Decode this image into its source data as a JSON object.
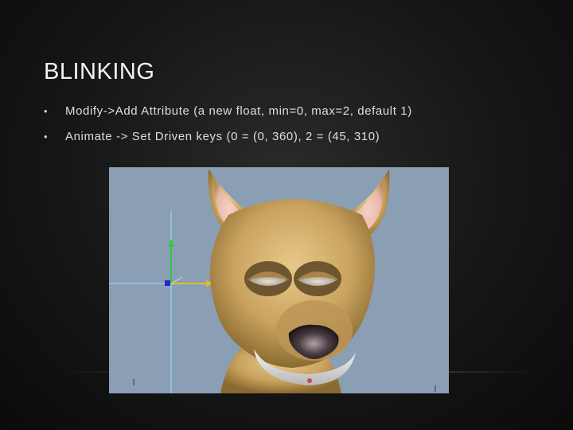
{
  "slide": {
    "title": "BLINKING",
    "bullets": [
      {
        "marker": "•",
        "text": "Modify->Add Attribute (a new float, min=0, max=2, default 1)"
      },
      {
        "marker": "•",
        "text": "Animate -> Set Driven keys (0 = (0, 360), 2 = (45, 310)"
      }
    ]
  },
  "viewport": {
    "background_color": "#8a9fb4",
    "grid_line_color": "#98e0ff",
    "fur_color": "#c9a35e",
    "collar_color": "#e6e6e6",
    "manipulator": {
      "y_axis_color": "#2ecc40",
      "x_axis_color": "#e0c020",
      "z_axis_color": "#2030c0",
      "icons": [
        "move-manipulator-icon"
      ]
    }
  }
}
